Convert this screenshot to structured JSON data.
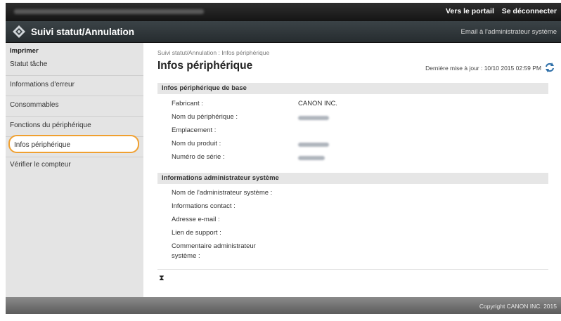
{
  "topbar": {
    "portal_link": "Vers le portail",
    "logout_link": "Se déconnecter"
  },
  "header": {
    "title": "Suivi statut/Annulation",
    "email_admin": "Email à l'administrateur système"
  },
  "sidebar": {
    "category": "Imprimer",
    "items": [
      {
        "label": "Statut tâche"
      },
      {
        "label": "Informations d'erreur"
      },
      {
        "label": "Consommables"
      },
      {
        "label": "Fonctions du périphérique"
      },
      {
        "label": "Infos périphérique"
      },
      {
        "label": "Vérifier le compteur"
      }
    ]
  },
  "main": {
    "breadcrumb": "Suivi statut/Annulation : Infos périphérique",
    "title": "Infos périphérique",
    "last_updated": "Dernière mise à jour : 10/10 2015 02:59 PM",
    "sections": [
      {
        "title": "Infos périphérique de base",
        "fields": [
          {
            "label": "Fabricant :",
            "value": "CANON INC."
          },
          {
            "label": "Nom du périphérique :"
          },
          {
            "label": "Emplacement :"
          },
          {
            "label": "Nom du produit :"
          },
          {
            "label": "Numéro de série :"
          }
        ]
      },
      {
        "title": "Informations administrateur système",
        "fields": [
          {
            "label": "Nom de l'administrateur système :"
          },
          {
            "label": "Informations contact :"
          },
          {
            "label": "Adresse e-mail :"
          },
          {
            "label": "Lien de support :"
          },
          {
            "label": "Commentaire administrateur"
          },
          {
            "label": "système :"
          }
        ]
      }
    ],
    "top_arrow": "⧗"
  },
  "footer": {
    "copyright": "Copyright CANON INC. 2015"
  },
  "colors": {
    "selected_outline": "#f0a030",
    "header_bg": "#2e3538",
    "sidebar_bg": "#e4e4e4"
  },
  "icons": {
    "logo": "diamond-logo-icon",
    "refresh": "refresh-icon",
    "top": "go-top-icon"
  }
}
